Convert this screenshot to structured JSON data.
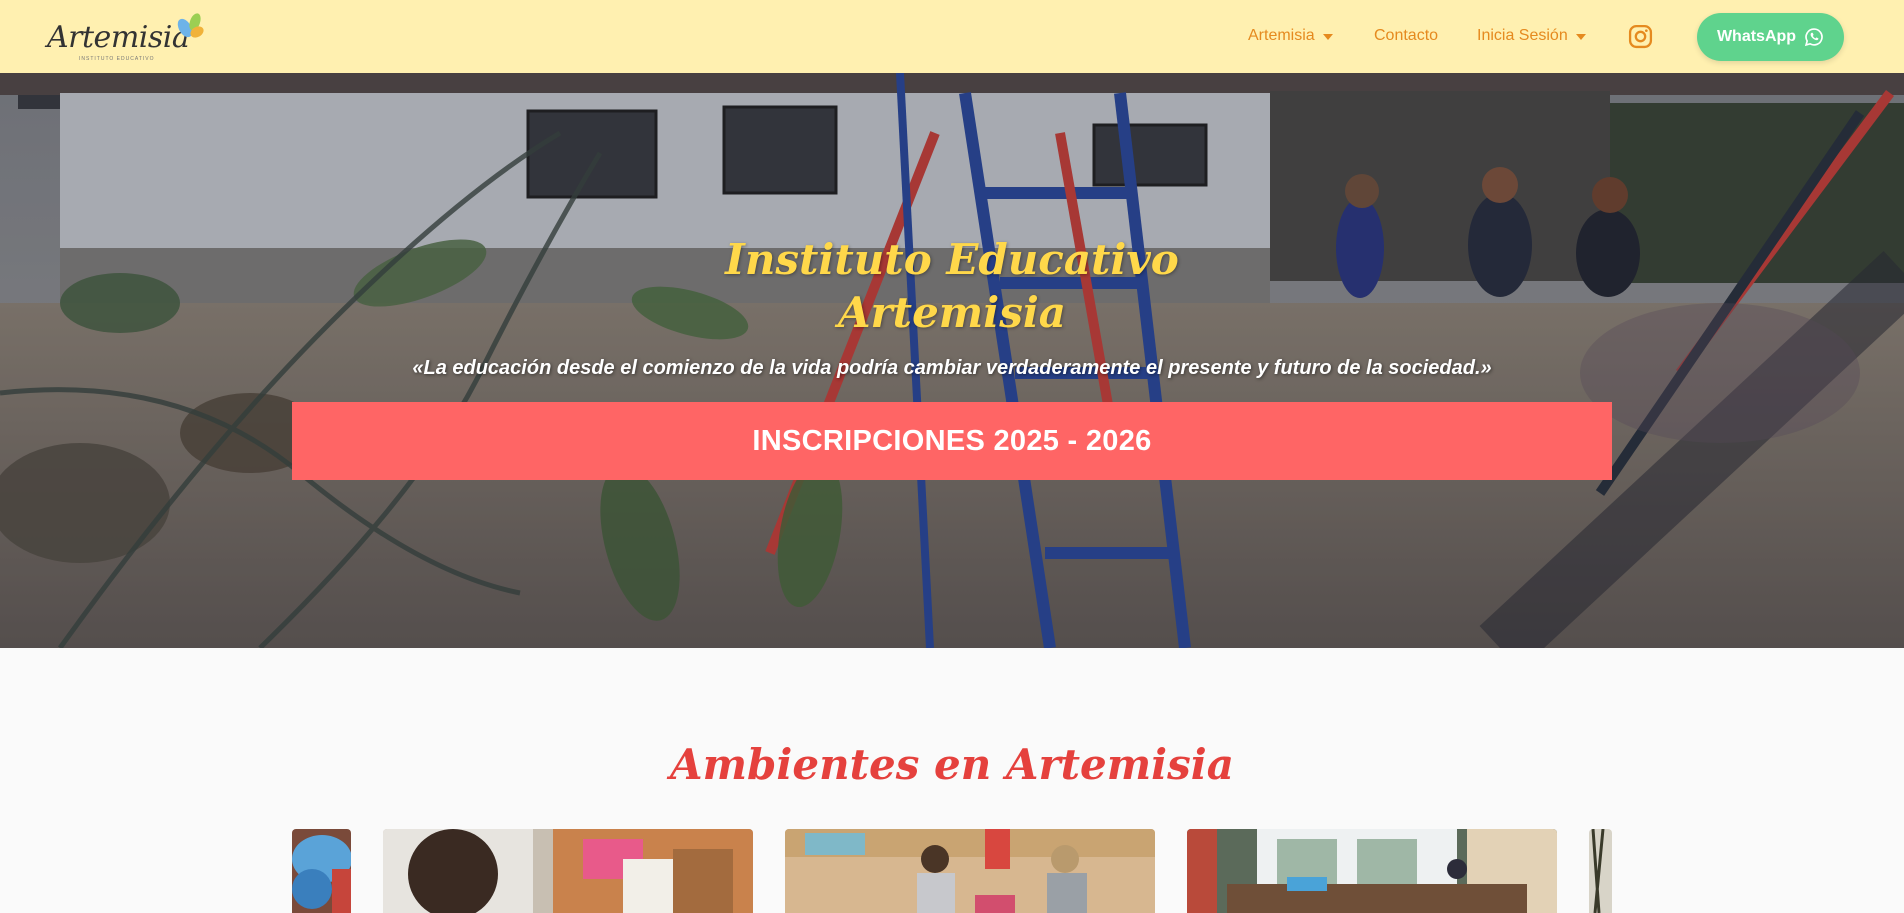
{
  "header": {
    "logo_text": "Artemisia",
    "logo_sub": "INSTITUTO EDUCATIVO",
    "nav": [
      {
        "label": "Artemisia",
        "has_dropdown": true
      },
      {
        "label": "Contacto",
        "has_dropdown": false
      },
      {
        "label": "Inicia Sesión",
        "has_dropdown": true
      }
    ],
    "instagram_icon": "instagram-icon",
    "whatsapp_label": "WhatsApp",
    "whatsapp_icon": "whatsapp-icon",
    "colors": {
      "bar": "#fff0b0",
      "nav_text": "#e58a1f",
      "whatsapp": "#5fd38d"
    }
  },
  "hero": {
    "title_line1": "Instituto Educativo",
    "title_line2": "Artemisia",
    "quote": "«La educación desde el comienzo de la vida podría cambiar verdaderamente el presente y futuro de la sociedad.»",
    "cta_label": "INSCRIPCIONES 2025 - 2026",
    "colors": {
      "title": "#ffd84a",
      "cta": "#ff6565"
    }
  },
  "section": {
    "title": "Ambientes en Artemisia",
    "title_color": "#e5413d"
  }
}
